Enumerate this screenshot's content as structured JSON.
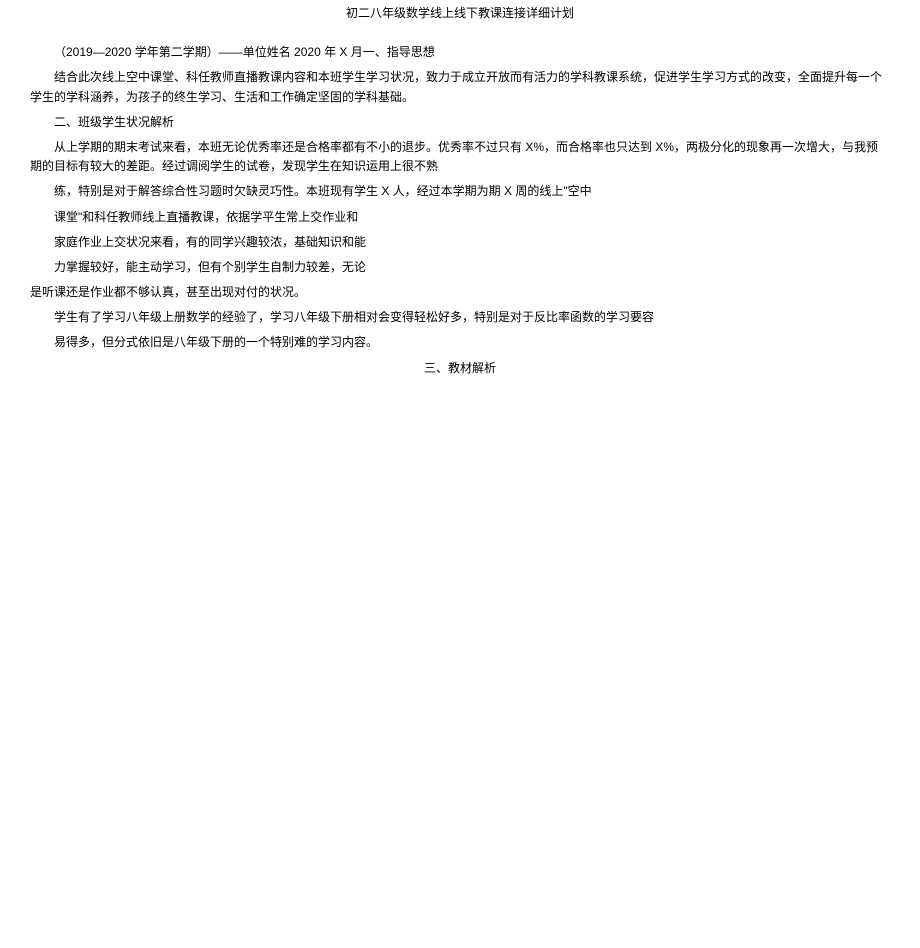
{
  "title": "初二八年级数学线上线下教课连接详细计划",
  "p1": "（2019—2020 学年第二学期）——单位姓名 2020 年 X 月一、指导思想",
  "p2": "结合此次线上空中课堂、科任教师直播教课内容和本班学生学习状况，致力于成立开放而有活力的学科教课系统，促进学生学习方式的改变，全面提升每一个学生的学科涵养，为孩子的终生学习、生活和工作确定坚固的学科基础。",
  "p3": "二、班级学生状况解析",
  "p4": "从上学期的期末考试来看，本班无论优秀率还是合格率都有不小的退步。优秀率不过只有 X%，而合格率也只达到 X%，两极分化的现象再一次增大，与我预期的目标有较大的差距。经过调阅学生的试卷，发现学生在知识运用上很不熟",
  "p5": "练，特别是对于解答综合性习题时欠缺灵巧性。本班现有学生 X 人，经过本学期为期 X 周的线上\"空中",
  "p6": "课堂\"和科任教师线上直播教课，依据学平生常上交作业和",
  "p7": "家庭作业上交状况来看，有的同学兴趣较浓，基础知识和能",
  "p8": "力掌握较好，能主动学习，但有个别学生自制力较差，无论",
  "p9": "是听课还是作业都不够认真，甚至出现对付的状况。",
  "p10": "学生有了学习八年级上册数学的经验了，学习八年级下册相对会变得轻松好多，特别是对于反比率函数的学习要容",
  "p11": "易得多，但分式依旧是八年级下册的一个特别难的学习内容。",
  "p12": "三、教材解析"
}
